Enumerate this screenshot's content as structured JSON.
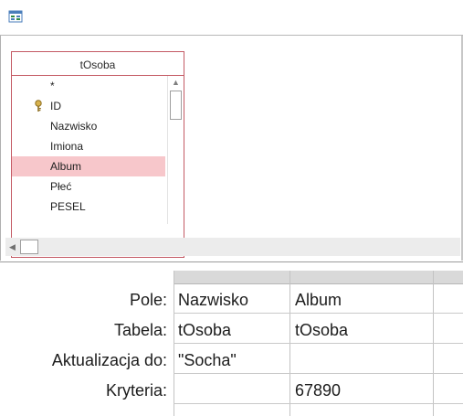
{
  "upper": {
    "table": {
      "name": "tOsoba",
      "fields": [
        {
          "label": "*",
          "primary_key": false,
          "selected": false
        },
        {
          "label": "ID",
          "primary_key": true,
          "selected": false
        },
        {
          "label": "Nazwisko",
          "primary_key": false,
          "selected": false
        },
        {
          "label": "Imiona",
          "primary_key": false,
          "selected": false
        },
        {
          "label": "Album",
          "primary_key": false,
          "selected": true
        },
        {
          "label": "Płeć",
          "primary_key": false,
          "selected": false
        },
        {
          "label": "PESEL",
          "primary_key": false,
          "selected": false
        }
      ]
    }
  },
  "grid": {
    "row_labels": {
      "field": "Pole:",
      "table": "Tabela:",
      "update_to": "Aktualizacja do:",
      "criteria": "Kryteria:"
    },
    "columns": [
      {
        "field": "Nazwisko",
        "table": "tOsoba",
        "update_to": "\"Socha\"",
        "criteria": ""
      },
      {
        "field": "Album",
        "table": "tOsoba",
        "update_to": "",
        "criteria": "67890"
      }
    ]
  },
  "colors": {
    "table_border": "#c45a64",
    "selected_row": "#f7c7cb"
  }
}
